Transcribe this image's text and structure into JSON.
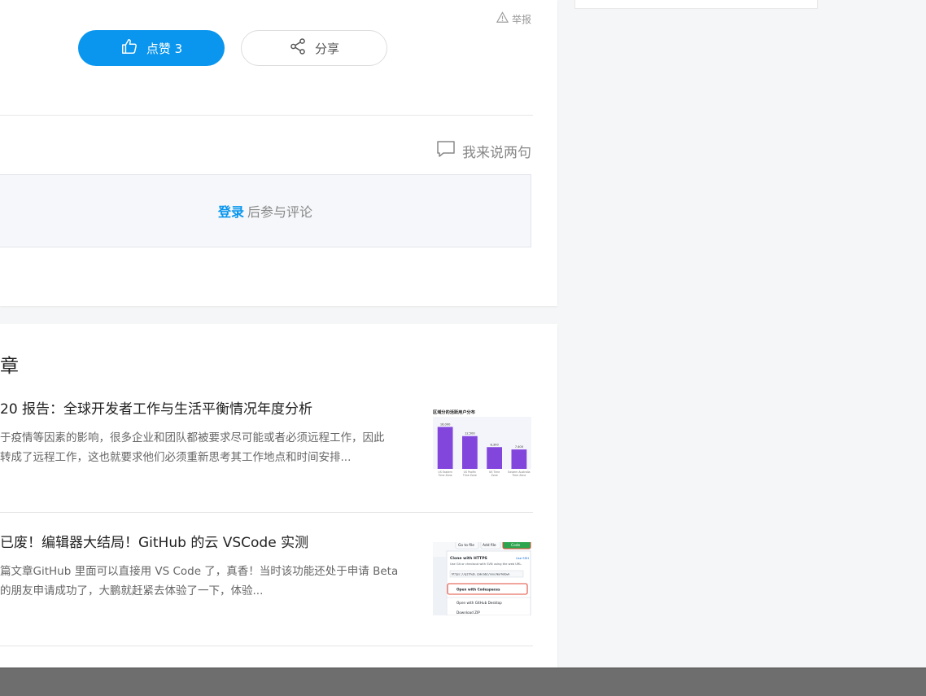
{
  "actions": {
    "report_label": "举报",
    "like_label": "点赞 3",
    "share_label": "分享"
  },
  "comments": {
    "prompt_label": "我来说两句",
    "login_link": "登录",
    "login_suffix": "后参与评论"
  },
  "related": {
    "section_title": "章",
    "articles": [
      {
        "title": "20 报告：全球开发者工作与生活平衡情况年度分析",
        "summary_line1": "于疫情等因素的影响，很多企业和团队都被要求尽可能或者必须远程工作，因此",
        "summary_line2": "转成了远程工作，这也就要求他们必须重新思考其工作地点和时间安排..."
      },
      {
        "title": "已废！编辑器大结局！GitHub 的云 VSCode 实测",
        "summary_line1": "篇文章GitHub 里面可以直接用 VS Code 了，真香！当时该功能还处于申请 Beta",
        "summary_line2": "的朋友申请成功了，大鹏就赶紧去体验了一下，体验..."
      }
    ]
  },
  "thumb1_chart": {
    "chart_data": {
      "type": "bar",
      "title": "区域分的活跃用户分布",
      "categories": [
        "US Eastern Time Zone",
        "US Pacific Time Zone",
        "UK Time Zone",
        "Eastern Australia Time Zone"
      ],
      "values": [
        16000,
        12500,
        8300,
        7400
      ],
      "value_labels": [
        "16,000",
        "12,500",
        "8,300",
        "7,400"
      ],
      "ylim": [
        0,
        18000
      ]
    }
  },
  "thumb2": {
    "btn_go_to_file": "Go to file",
    "btn_add_file": "Add file",
    "btn_code": "Code",
    "clone_title": "Clone with HTTPS",
    "use_ssh": "Use SSH",
    "clone_desc": "Use Git or checkout with SVN using the web URL.",
    "clone_url": "https://github.com/abc/xxx/markdown",
    "open_codespaces": "Open with Codespaces",
    "open_desktop": "Open with GitHub Desktop",
    "download_zip": "Download ZIP"
  },
  "colors": {
    "accent": "#0a96ee",
    "bar": "#8246dd",
    "highlight_border": "#e24b3b",
    "code_btn": "#2da44e"
  }
}
